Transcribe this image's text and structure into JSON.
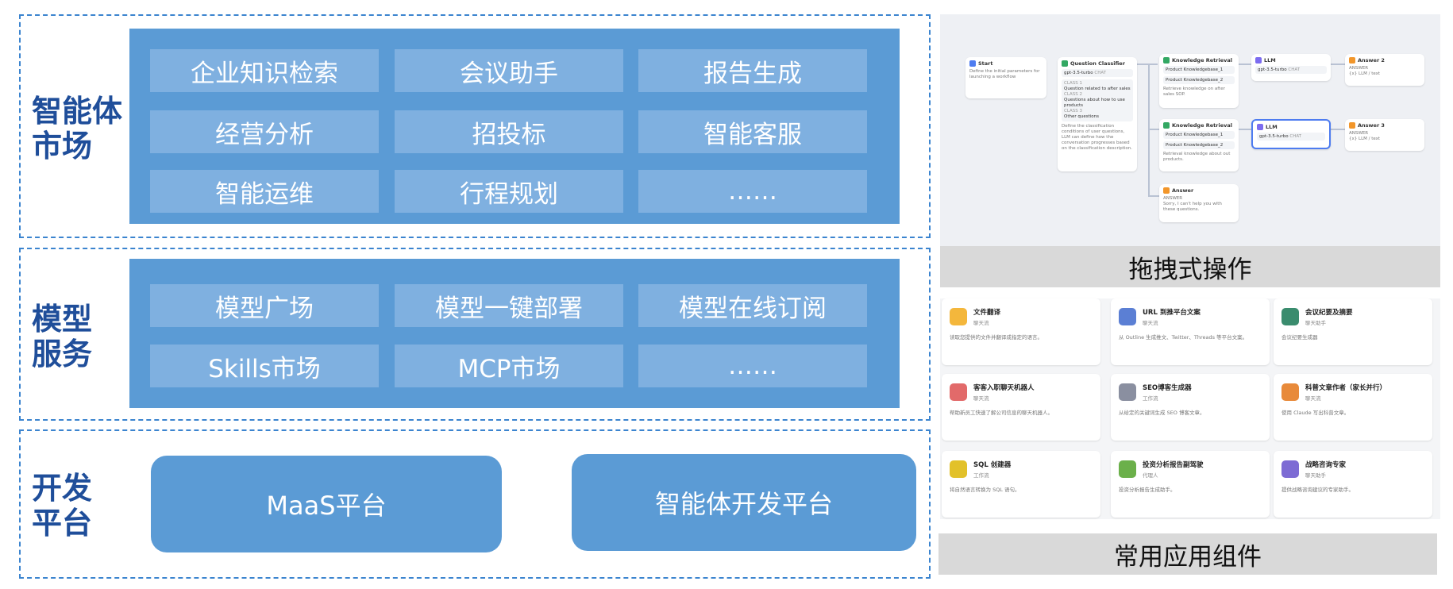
{
  "layers": {
    "agent_market": {
      "title": "智能体\n市场",
      "tiles": [
        "企业知识检索",
        "会议助手",
        "报告生成",
        "经营分析",
        "招投标",
        "智能客服",
        "智能运维",
        "行程规划",
        "……"
      ]
    },
    "model_service": {
      "title": "模型\n服务",
      "tiles": [
        "模型广场",
        "模型一键部署",
        "模型在线订阅",
        "Skills市场",
        "MCP市场",
        "……"
      ]
    },
    "dev_platform": {
      "title": "开发\n平台",
      "platforms": [
        "MaaS平台",
        "智能体开发平台"
      ]
    }
  },
  "workflow": {
    "caption": "拖拽式操作",
    "nodes": {
      "start": {
        "title": "Start",
        "desc": "Define the initial parameters for launching a workflow"
      },
      "classifier": {
        "title": "Question Classifier",
        "model": "gpt-3.5-turbo",
        "tag": "CHAT",
        "classes": [
          "CLASS 1",
          "Question related to after sales",
          "CLASS 2",
          "Questions about how to use products",
          "CLASS 3",
          "Other questions"
        ],
        "desc": "Define the classification conditions of user questions, LLM can define how the conversation progresses based on the classification description."
      },
      "kr1": {
        "title": "Knowledge Retrieval",
        "items": [
          "Product Knowledgebase_1",
          "Product Knowledgebase_2"
        ],
        "desc": "Retrieve knowledge on after sales SOP."
      },
      "kr2": {
        "title": "Knowledge Retrieval",
        "items": [
          "Product Knowledgebase_1",
          "Product Knowledgebase_2"
        ],
        "desc": "Retrieval knowledge about out products."
      },
      "llm1": {
        "title": "LLM",
        "model": "gpt-3.5-turbo",
        "tag": "CHAT"
      },
      "llm2": {
        "title": "LLM",
        "model": "gpt-3.5-turbo",
        "tag": "CHAT"
      },
      "ans2": {
        "title": "Answer 2",
        "label": "ANSWER",
        "value": "{x} LLM / text"
      },
      "ans3": {
        "title": "Answer 3",
        "label": "ANSWER",
        "value": "{x} LLM / text"
      },
      "ans": {
        "title": "Answer",
        "label": "ANSWER",
        "value": "Sorry, I can't help you with these questions."
      }
    }
  },
  "components": {
    "caption": "常用应用组件",
    "cards": [
      {
        "name": "文件翻译",
        "type": "聊天流",
        "desc": "读取您提供的文件并翻译成指定的语言。",
        "color": "#f4b73c"
      },
      {
        "name": "URL 到推平台文案",
        "type": "聊天流",
        "desc": "从 Outline 生成推文、Twitter、Threads 等平台文案。",
        "color": "#5b7fd4"
      },
      {
        "name": "会议纪要及摘要",
        "type": "聊天助手",
        "desc": "会议纪要生成器",
        "color": "#3a8c6e"
      },
      {
        "name": "客客入职聊天机器人",
        "type": "聊天流",
        "desc": "帮助新员工快速了解公司信息的聊天机器人。",
        "color": "#e26a6a"
      },
      {
        "name": "SEO博客生成器",
        "type": "工作流",
        "desc": "从给定的关键词生成 SEO 博客文章。",
        "color": "#8a8fa0"
      },
      {
        "name": "科普文章作者（家长并行）",
        "type": "聊天流",
        "desc": "使用 Claude 写出科普文章。",
        "color": "#e88a3a"
      },
      {
        "name": "SQL 创建器",
        "type": "工作流",
        "desc": "将自然语言转换为 SQL 语句。",
        "color": "#e2c12a"
      },
      {
        "name": "投资分析报告副驾驶",
        "type": "代理人",
        "desc": "投资分析报告生成助手。",
        "color": "#6bb04a"
      },
      {
        "name": "战略咨询专家",
        "type": "聊天助手",
        "desc": "提供战略咨询建议的专家助手。",
        "color": "#7d6bd4"
      }
    ]
  }
}
